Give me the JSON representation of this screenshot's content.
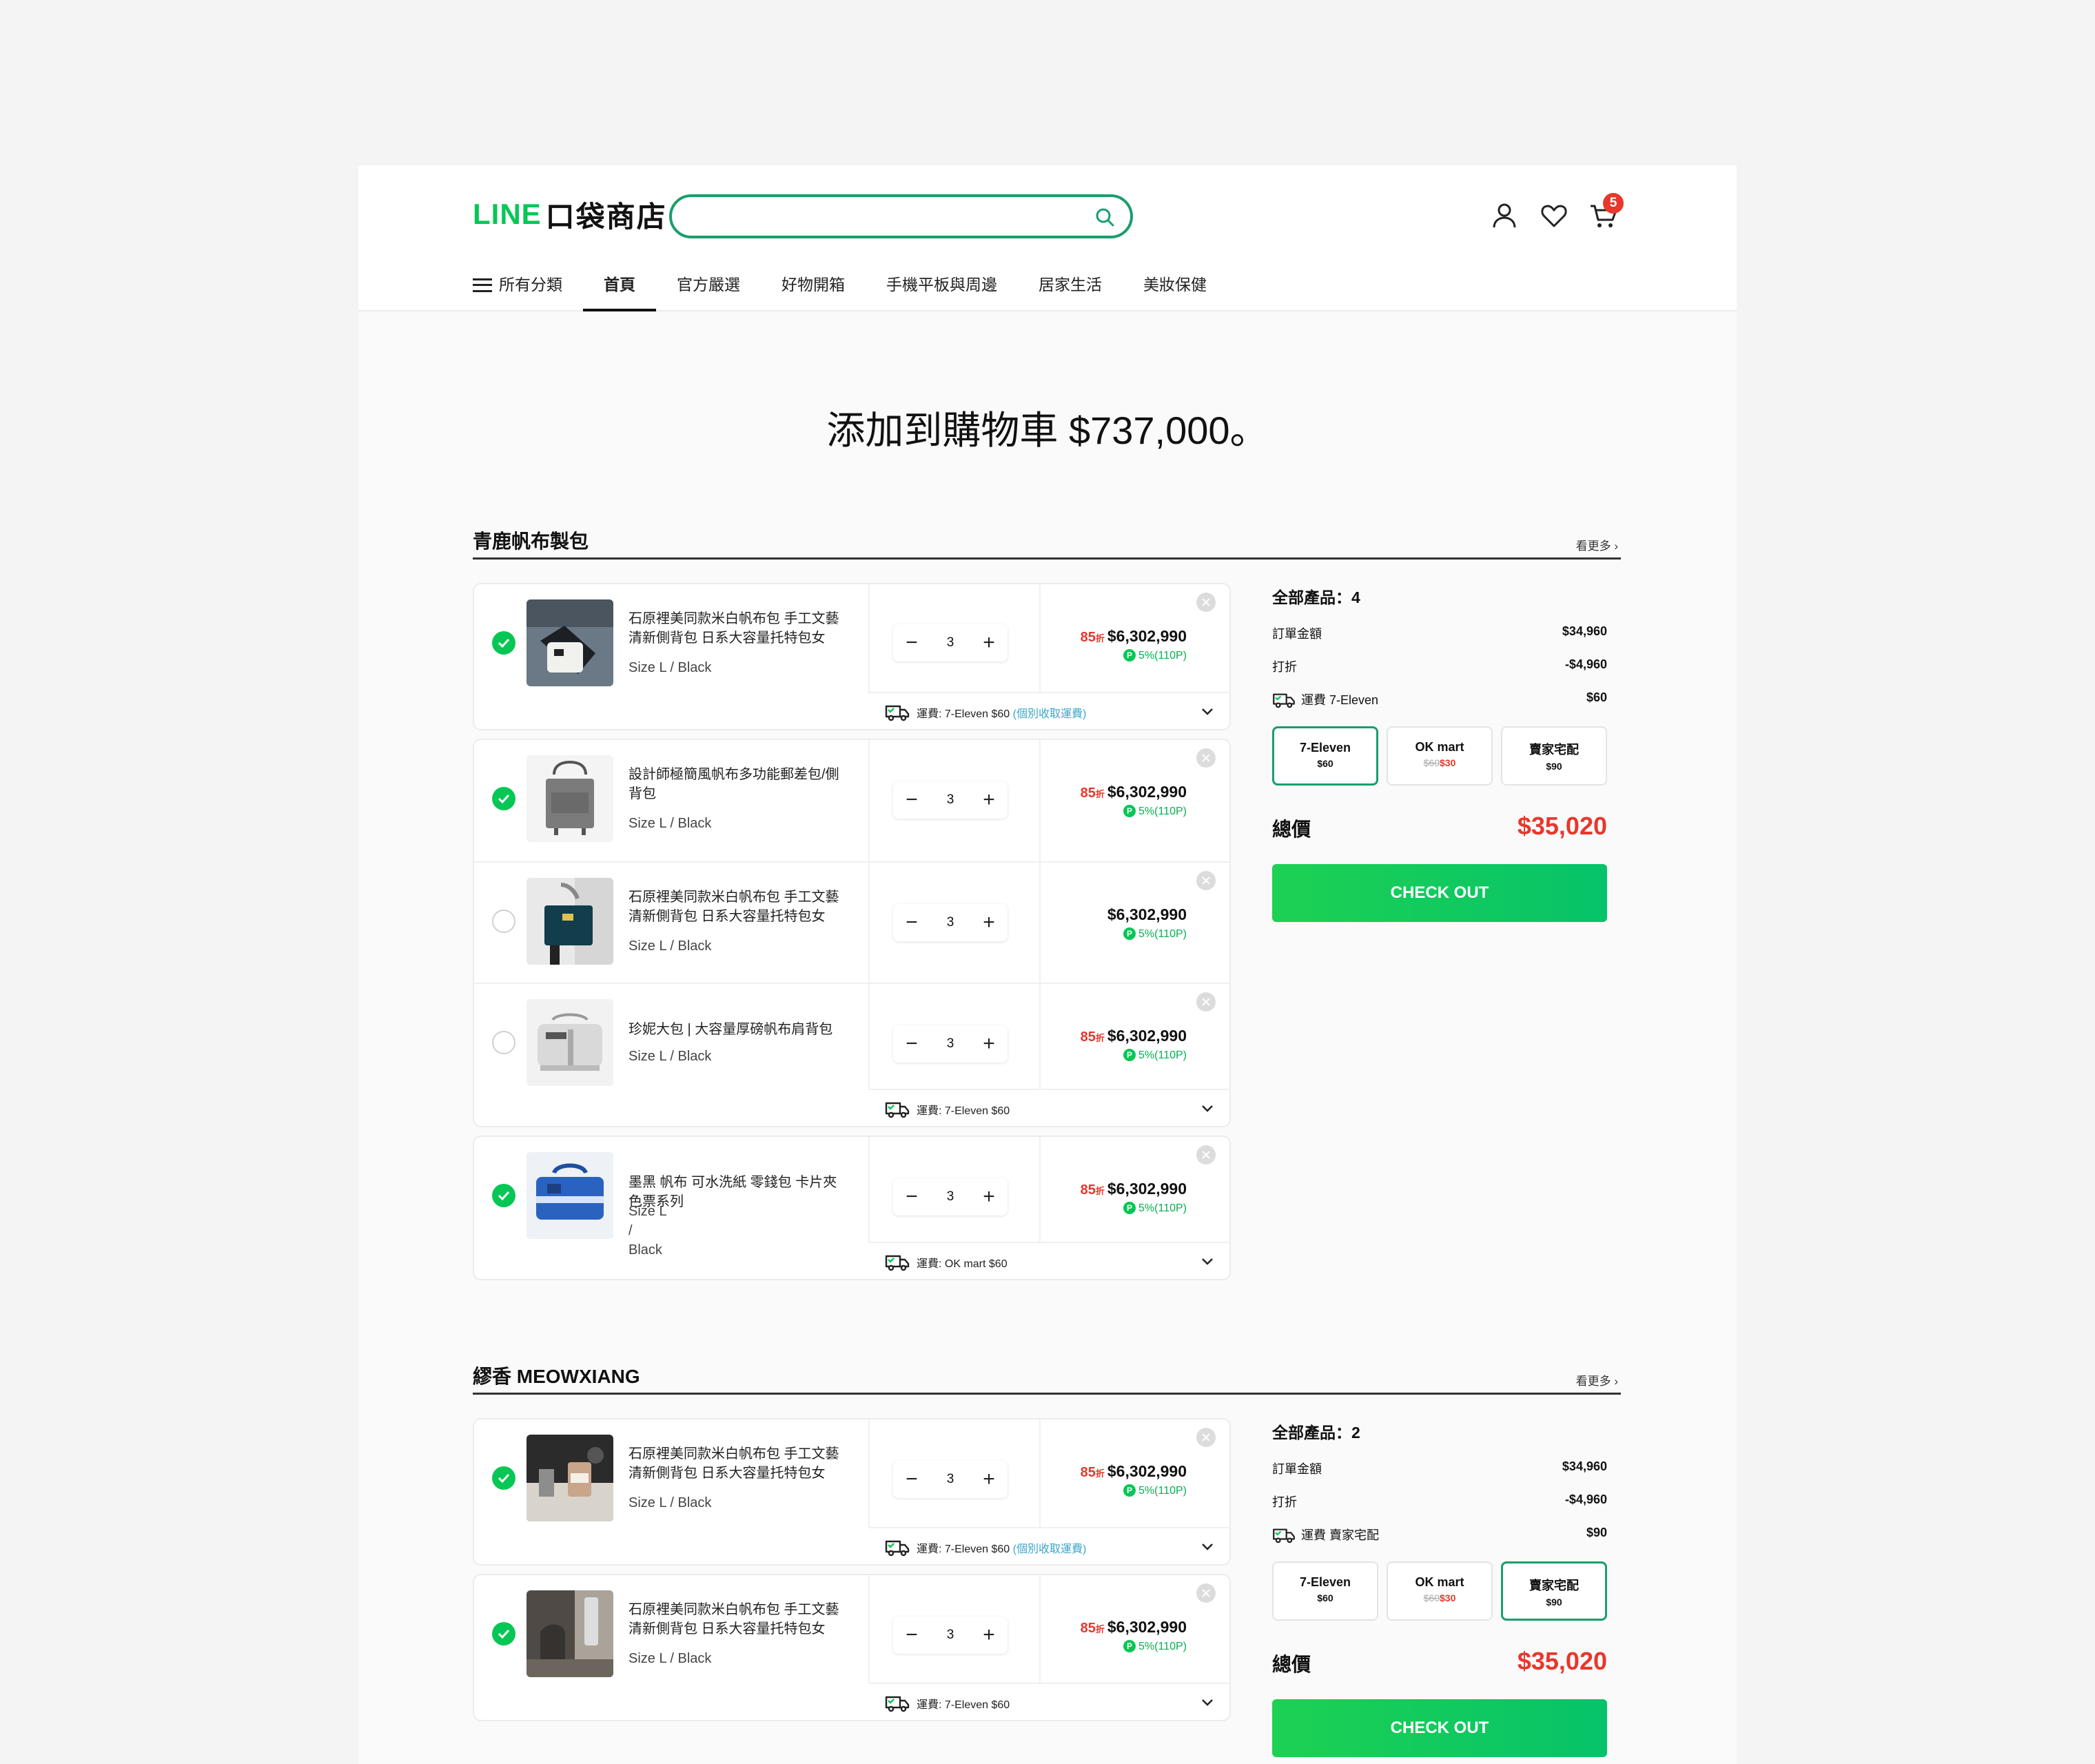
{
  "header": {
    "logo_line": "LINE",
    "logo_shop": "口袋商店",
    "search_placeholder": "",
    "cart_count": "5",
    "nav": [
      "所有分類",
      "首頁",
      "官方嚴選",
      "好物開箱",
      "手機平板與周邊",
      "居家生活",
      "美妝保健"
    ]
  },
  "page_title": "添加到購物車 $737,000。",
  "sections": [
    {
      "name": "青鹿帆布製包",
      "more": "看更多",
      "items": [
        {
          "name": "石原裡美同款米白帆布包 手工文藝清新側背包 日系大容量托特包女",
          "variant": "Size L / Black",
          "qty": "3",
          "discount": "85",
          "discount_unit": "折",
          "price": "$6,302,990",
          "points": "5%(110P)",
          "checked": true
        },
        {
          "name": "設計師極簡風帆布多功能郵差包/側背包",
          "variant": "Size L / Black",
          "qty": "3",
          "discount": "85",
          "discount_unit": "折",
          "price": "$6,302,990",
          "points": "5%(110P)",
          "checked": true
        },
        {
          "name": "石原裡美同款米白帆布包 手工文藝清新側背包 日系大容量托特包女",
          "variant": "Size L / Black",
          "qty": "3",
          "discount": "",
          "discount_unit": "",
          "price": "$6,302,990",
          "points": "5%(110P)",
          "checked": false
        },
        {
          "name": "珍妮大包 | 大容量厚磅帆布肩背包",
          "variant": "Size L / Black",
          "qty": "3",
          "discount": "85",
          "discount_unit": "折",
          "price": "$6,302,990",
          "points": "5%(110P)",
          "checked": false
        },
        {
          "name": "墨黑 帆布 可水洗紙 零錢包 卡片夾 色票系列",
          "variant": "Size L / Black",
          "qty": "3",
          "discount": "85",
          "discount_unit": "折",
          "price": "$6,302,990",
          "points": "5%(110P)",
          "checked": true
        }
      ],
      "shipping": [
        {
          "text": "運費: 7-Eleven $60",
          "note": "(個別收取運費)"
        },
        {
          "text": "運費: 7-Eleven $60",
          "note": ""
        },
        {
          "text": "運費: OK mart $60",
          "note": ""
        }
      ],
      "summary": {
        "title": "全部產品：4",
        "order_label": "訂單金額",
        "order_value": "$34,960",
        "discount_label": "打折",
        "discount_value": "-$4,960",
        "ship_label": "運費 7-Eleven",
        "ship_value": "$60",
        "options": [
          {
            "name": "7-Eleven",
            "old": "",
            "price": "$60"
          },
          {
            "name": "OK mart",
            "old": "$60",
            "price": "$30"
          },
          {
            "name": "賣家宅配",
            "old": "",
            "price": "$90"
          }
        ],
        "selected_option": 0,
        "total_label": "總價",
        "total_value": "$35,020",
        "checkout": "CHECK OUT"
      }
    },
    {
      "name": "繆香 MEOWXIANG",
      "more": "看更多",
      "items": [
        {
          "name": "石原裡美同款米白帆布包 手工文藝清新側背包 日系大容量托特包女",
          "variant": "Size L / Black",
          "qty": "3",
          "discount": "85",
          "discount_unit": "折",
          "price": "$6,302,990",
          "points": "5%(110P)",
          "checked": true
        },
        {
          "name": "石原裡美同款米白帆布包 手工文藝清新側背包 日系大容量托特包女",
          "variant": "Size L / Black",
          "qty": "3",
          "discount": "85",
          "discount_unit": "折",
          "price": "$6,302,990",
          "points": "5%(110P)",
          "checked": true
        }
      ],
      "shipping": [
        {
          "text": "運費: 7-Eleven $60",
          "note": "(個別收取運費)"
        },
        {
          "text": "運費: 7-Eleven $60",
          "note": ""
        }
      ],
      "summary": {
        "title": "全部產品：2",
        "order_label": "訂單金額",
        "order_value": "$34,960",
        "discount_label": "打折",
        "discount_value": "-$4,960",
        "ship_label": "運費 賣家宅配",
        "ship_value": "$90",
        "options": [
          {
            "name": "7-Eleven",
            "old": "",
            "price": "$60"
          },
          {
            "name": "OK mart",
            "old": "$60",
            "price": "$30"
          },
          {
            "name": "賣家宅配",
            "old": "",
            "price": "$90"
          }
        ],
        "selected_option": 2,
        "total_label": "總價",
        "total_value": "$35,020",
        "checkout": "CHECK OUT"
      }
    }
  ],
  "colors": {
    "brand_green": "#06c755",
    "accent_teal": "#1a9e6c",
    "price_red": "#e8372c",
    "points_green": "#06b050",
    "note_blue": "#3ba6c9"
  },
  "icons": [
    "search-icon",
    "user-icon",
    "heart-icon",
    "cart-icon",
    "menu-icon",
    "check-icon",
    "close-icon",
    "truck-icon",
    "chevron-down-icon",
    "chevron-right-icon"
  ]
}
